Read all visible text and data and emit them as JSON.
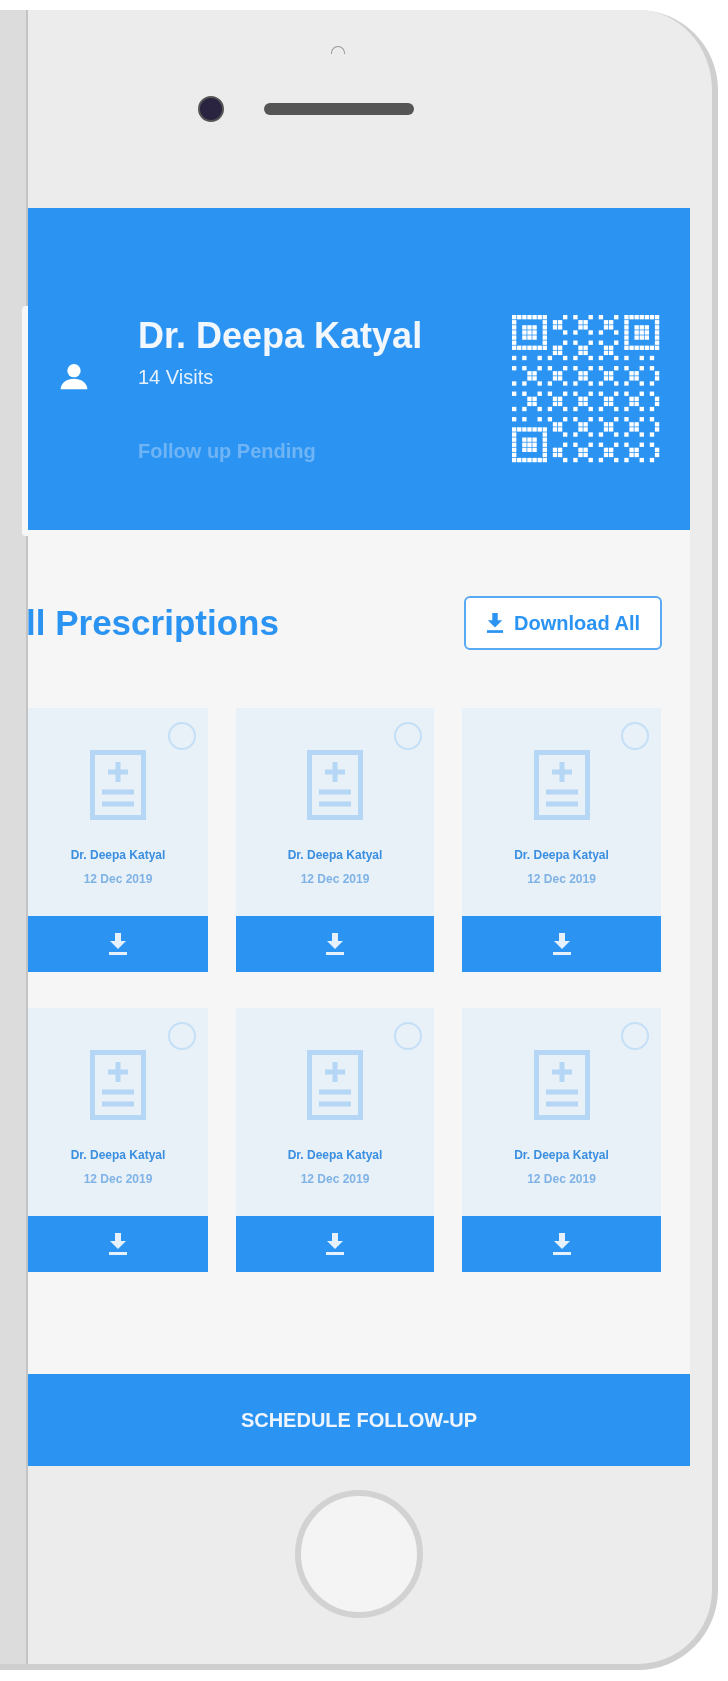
{
  "header": {
    "name": "Dr. Deepa Katyal",
    "visits": "14 Visits",
    "status": "Follow up Pending"
  },
  "section": {
    "title": "ll Prescriptions",
    "download_button": "Download All"
  },
  "prescriptions": [
    {
      "doctor": "Dr. Deepa Katyal",
      "date": "12 Dec 2019",
      "selected": false
    },
    {
      "doctor": "Dr. Deepa Katyal",
      "date": "12 Dec 2019",
      "selected": false
    },
    {
      "doctor": "Dr. Deepa Katyal",
      "date": "12 Dec 2019",
      "selected": false
    },
    {
      "doctor": "Dr. Deepa Katyal",
      "date": "12 Dec 2019",
      "selected": false
    },
    {
      "doctor": "Dr. Deepa Katyal",
      "date": "12 Dec 2019",
      "selected": false
    },
    {
      "doctor": "Dr. Deepa Katyal",
      "date": "12 Dec 2019",
      "selected": false
    }
  ],
  "schedule_button": "SCHEDULE FOLLOW-UP"
}
